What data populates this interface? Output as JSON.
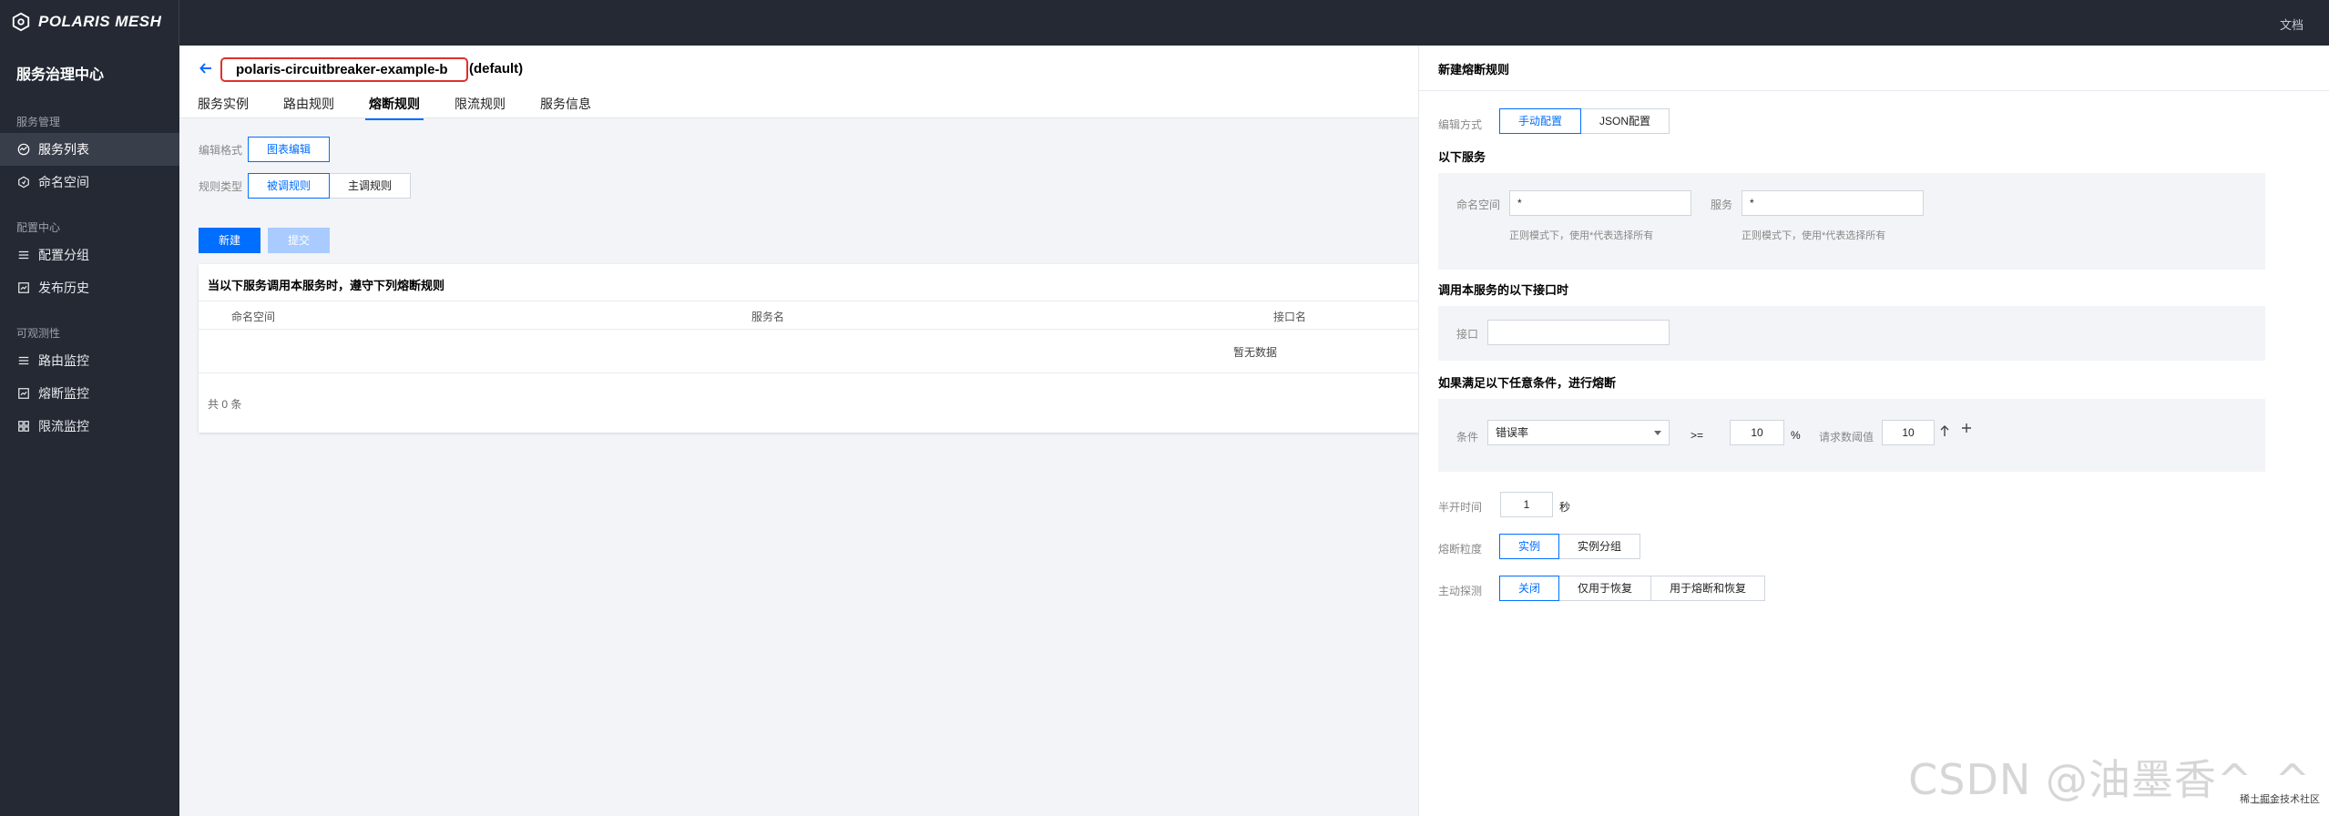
{
  "topbar": {
    "brand": "POLARIS MESH",
    "doc_link": "文档"
  },
  "sidebar": {
    "title": "服务治理中心",
    "groups": [
      {
        "label": "服务管理",
        "items": [
          {
            "label": "服务列表",
            "icon": "gauge-icon",
            "active": true
          },
          {
            "label": "命名空间",
            "icon": "hexagon-icon"
          }
        ]
      },
      {
        "label": "配置中心",
        "items": [
          {
            "label": "配置分组",
            "icon": "list-icon"
          },
          {
            "label": "发布历史",
            "icon": "history-icon"
          }
        ]
      },
      {
        "label": "可观测性",
        "items": [
          {
            "label": "路由监控",
            "icon": "list-icon"
          },
          {
            "label": "熔断监控",
            "icon": "chart-icon"
          },
          {
            "label": "限流监控",
            "icon": "grid-icon"
          }
        ]
      }
    ]
  },
  "main": {
    "service_name": "polaris-circuitbreaker-example-b",
    "service_ns": "(default)",
    "tabs": [
      "服务实例",
      "路由规则",
      "熔断规则",
      "限流规则",
      "服务信息"
    ],
    "active_tab": "熔断规则",
    "edit_format_label": "编辑格式",
    "edit_format_option": "图表编辑",
    "rule_type_label": "规则类型",
    "rule_type_options": [
      "被调规则",
      "主调规则"
    ],
    "new_button": "新建",
    "submit_button": "提交",
    "table_caption": "当以下服务调用本服务时，遵守下列熔断规则",
    "columns": [
      "命名空间",
      "服务名",
      "接口名"
    ],
    "empty_text": "暂无数据",
    "total_text": "共 0 条"
  },
  "drawer": {
    "title": "新建熔断规则",
    "edit_mode_label": "编辑方式",
    "edit_mode_options": [
      "手动配置",
      "JSON配置"
    ],
    "section_services": "以下服务",
    "namespace_label": "命名空间",
    "namespace_value": "*",
    "namespace_hint": "正则模式下，使用*代表选择所有",
    "service_label": "服务",
    "service_value": "*",
    "service_hint": "正则模式下，使用*代表选择所有",
    "section_interface": "调用本服务的以下接口时",
    "interface_label": "接口",
    "interface_value": "",
    "section_conditions": "如果满足以下任意条件，进行熔断",
    "condition_label": "条件",
    "condition_value": "错误率",
    "operator": ">=",
    "threshold_value": "10",
    "threshold_unit": "%",
    "min_requests_label": "请求数阈值",
    "min_requests_value": "10",
    "half_open_label": "半开时间",
    "half_open_value": "1",
    "half_open_unit": "秒",
    "granularity_label": "熔断粒度",
    "granularity_options": [
      "实例",
      "实例分组"
    ],
    "probe_label": "主动探测",
    "probe_options": [
      "关闭",
      "仅用于恢复",
      "用于熔断和恢复"
    ]
  },
  "watermark": {
    "text": "CSDN @油墨香^_^",
    "small": "稀土掘金技术社区"
  },
  "colors": {
    "accent": "#006eff",
    "sidebar_bg": "#242933",
    "highlight_border": "#e02f2f"
  }
}
